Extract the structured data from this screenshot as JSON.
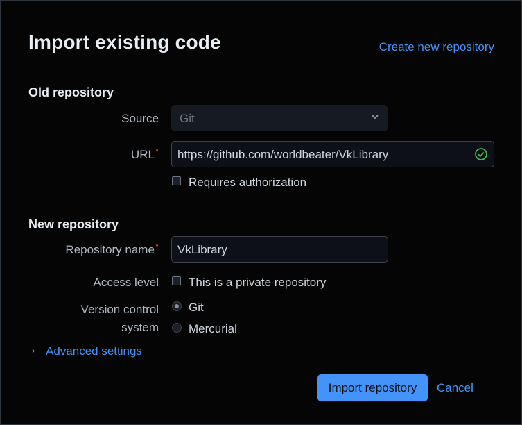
{
  "header": {
    "title": "Import existing code",
    "create_link": "Create new repository"
  },
  "old_repo": {
    "section_title": "Old repository",
    "source_label": "Source",
    "source_value": "Git",
    "url_label": "URL",
    "required_mark": "*",
    "url_value": "https://github.com/worldbeater/VkLibrary",
    "url_valid_icon": "check-circle-icon",
    "requires_auth_label": "Requires authorization",
    "requires_auth_checked": false
  },
  "new_repo": {
    "section_title": "New repository",
    "name_label": "Repository name",
    "required_mark": "*",
    "name_value": "VkLibrary",
    "access_label": "Access level",
    "private_label": "This is a private repository",
    "private_checked": false,
    "vcs_label_line1": "Version control",
    "vcs_label_line2": "system",
    "vcs_options": [
      {
        "label": "Git",
        "selected": true
      },
      {
        "label": "Mercurial",
        "selected": false
      }
    ]
  },
  "advanced": {
    "label": "Advanced settings"
  },
  "footer": {
    "import_label": "Import repository",
    "cancel_label": "Cancel"
  },
  "colors": {
    "background": "#000000",
    "accent": "#4493f8",
    "success": "#3fb950",
    "required": "#f85149"
  }
}
